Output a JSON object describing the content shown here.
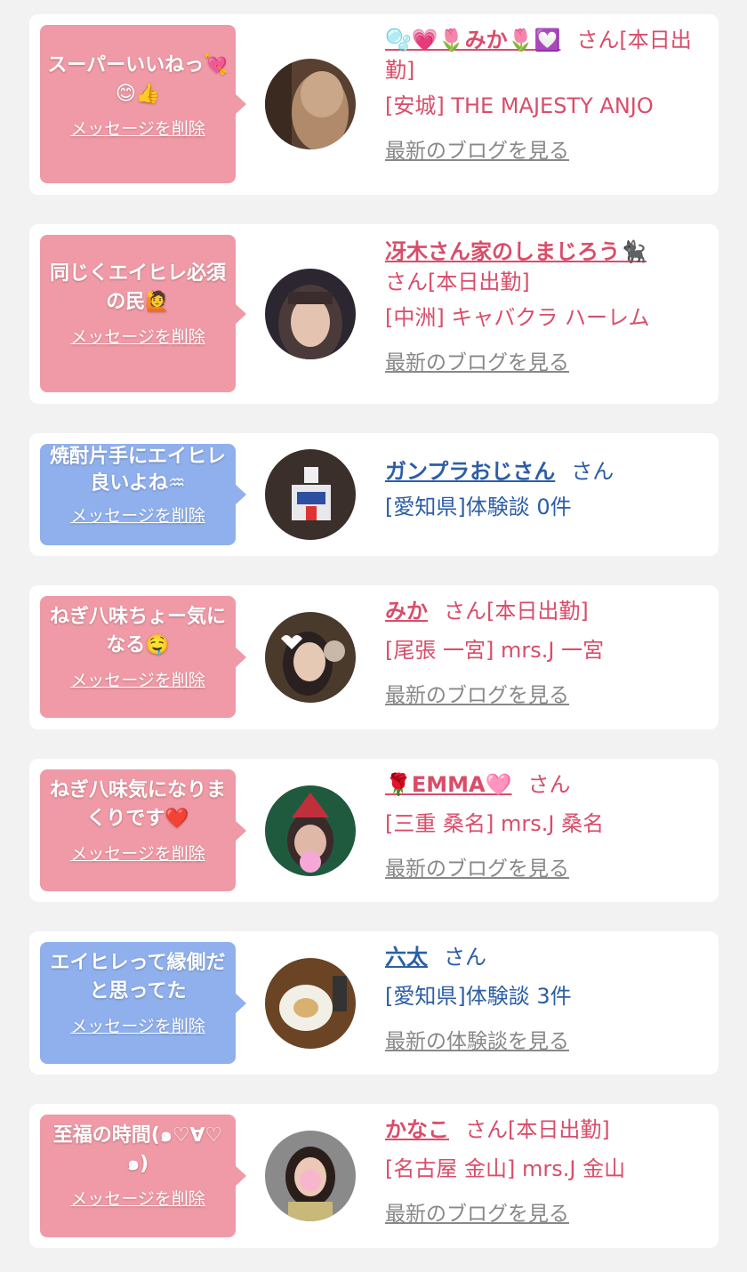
{
  "colors": {
    "bubble_pink": "#ef9aa6",
    "bubble_blue": "#8fb0ec",
    "cast_text": "#d94d6a",
    "user_text": "#2c5ea6",
    "link_gray": "#888888",
    "background": "#f2f2f2"
  },
  "delete_label": "メッセージを削除",
  "items": [
    {
      "bubble_color": "pink",
      "message": "スーパーいいねっ💘😊👍",
      "name": "🫧💗🌷みか🌷💟",
      "name_suffix": "さん[本日出勤]",
      "detail": "[安城] THE MAJESTY ANJO",
      "link": "最新のブログを見る",
      "avatar_icon": "cast-photo-avatar"
    },
    {
      "bubble_color": "pink",
      "message": "同じくエイヒレ必須の民🙋",
      "name": "冴木さん家のしまじろう🐈‍⬛",
      "name_suffix": "さん[本日出勤]",
      "detail": "[中洲] キャバクラ ハーレム",
      "link": "最新のブログを見る",
      "avatar_icon": "cast-photo-avatar"
    },
    {
      "bubble_color": "blue",
      "message": "焼酎片手にエイヒレ良いよね♒",
      "name": "ガンプラおじさん",
      "name_suffix": "さん",
      "detail": "[愛知県]体験談 0件",
      "link": "",
      "avatar_icon": "robot-figure-avatar"
    },
    {
      "bubble_color": "pink",
      "message": "ねぎ八味ちょー気になる🤤",
      "name": "みか",
      "name_suffix": "さん[本日出勤]",
      "detail": "[尾張 一宮] mrs.J 一宮",
      "link": "最新のブログを見る",
      "avatar_icon": "cast-photo-avatar"
    },
    {
      "bubble_color": "pink",
      "message": "ねぎ八味気になりまくりです❤️",
      "name": "🌹EMMA🩷",
      "name_suffix": "さん",
      "detail": "[三重 桑名] mrs.J 桑名",
      "link": "最新のブログを見る",
      "avatar_icon": "cast-photo-avatar"
    },
    {
      "bubble_color": "blue",
      "message": "エイヒレって縁側だと思ってた",
      "name": "六太",
      "name_suffix": "さん",
      "detail": "[愛知県]体験談 3件",
      "link": "最新の体験談を見る",
      "avatar_icon": "food-plate-avatar"
    },
    {
      "bubble_color": "pink",
      "message": "至福の時間(๑♡∀♡๑)",
      "name": "かなこ",
      "name_suffix": "さん[本日出勤]",
      "detail": "[名古屋 金山] mrs.J 金山",
      "link": "最新のブログを見る",
      "avatar_icon": "cast-photo-avatar"
    }
  ]
}
